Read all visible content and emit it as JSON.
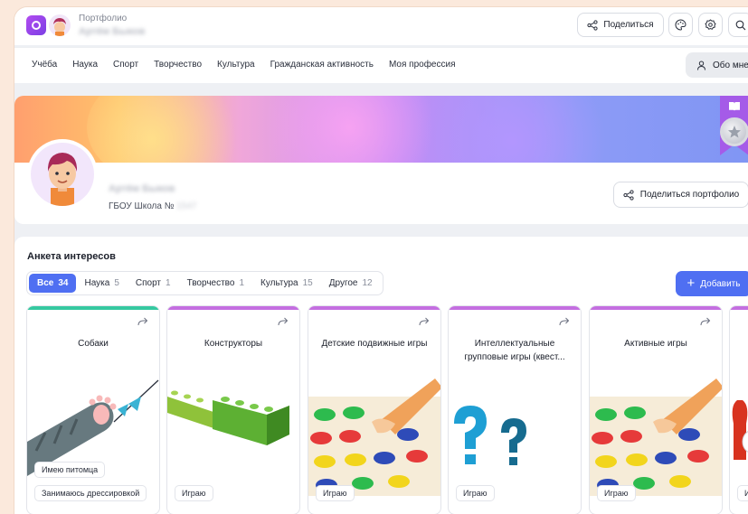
{
  "header": {
    "app_title": "Портфолио",
    "user_name": "Артём Быков",
    "share_label": "Поделиться"
  },
  "nav": {
    "items": [
      "Учёба",
      "Наука",
      "Спорт",
      "Творчество",
      "Культура",
      "Гражданская активность",
      "Моя профессия"
    ],
    "about_label": "Обо мне"
  },
  "profile": {
    "name": "Артём Быков",
    "school": "ГБОУ Школа №",
    "school_number": "1547",
    "share_portfolio_label": "Поделиться портфолио"
  },
  "interests": {
    "title": "Анкета интересов",
    "add_label": "Добавить",
    "tabs": [
      {
        "label": "Все",
        "count": "34"
      },
      {
        "label": "Наука",
        "count": "5"
      },
      {
        "label": "Спорт",
        "count": "1"
      },
      {
        "label": "Творчество",
        "count": "1"
      },
      {
        "label": "Культура",
        "count": "15"
      },
      {
        "label": "Другое",
        "count": "12"
      }
    ],
    "cards": [
      {
        "title": "Собаки",
        "tags": [
          "Имею питомца",
          "Занимаюсь дрессировкой"
        ],
        "accent": "#35c9a0"
      },
      {
        "title": "Конструкторы",
        "tags": [
          "Играю"
        ],
        "accent": "#c46ee0"
      },
      {
        "title": "Детские подвижные игры",
        "tags": [
          "Играю"
        ],
        "accent": "#c46ee0"
      },
      {
        "title": "Интеллектуальные групповые игры (квест...",
        "tags": [
          "Играю"
        ],
        "accent": "#c46ee0"
      },
      {
        "title": "Активные игры",
        "tags": [
          "Играю"
        ],
        "accent": "#c46ee0"
      },
      {
        "title": "",
        "tags": [
          "И"
        ],
        "accent": "#c46ee0"
      }
    ]
  },
  "colors": {
    "primary": "#4f6ff2",
    "accent_purple": "#a55be8",
    "accent_green": "#35c9a0"
  }
}
